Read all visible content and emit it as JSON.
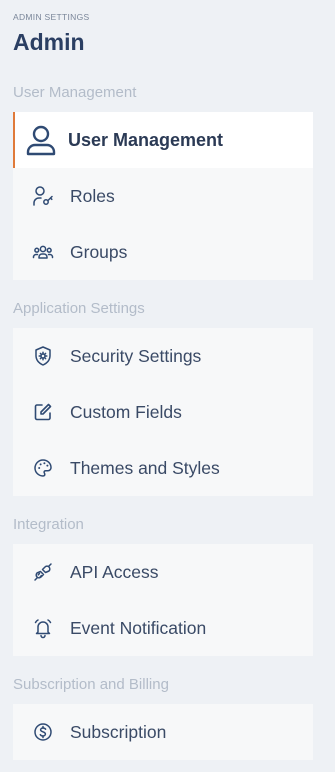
{
  "header": {
    "eyebrow": "ADMIN SETTINGS",
    "title": "Admin"
  },
  "sections": [
    {
      "label": "User Management",
      "items": [
        {
          "label": "User Management",
          "icon": "user-icon",
          "active": true
        },
        {
          "label": "Roles",
          "icon": "user-key-icon",
          "active": false
        },
        {
          "label": "Groups",
          "icon": "users-group-icon",
          "active": false
        }
      ]
    },
    {
      "label": "Application Settings",
      "items": [
        {
          "label": "Security Settings",
          "icon": "shield-gear-icon",
          "active": false
        },
        {
          "label": "Custom Fields",
          "icon": "edit-icon",
          "active": false
        },
        {
          "label": "Themes and Styles",
          "icon": "palette-icon",
          "active": false
        }
      ]
    },
    {
      "label": "Integration",
      "items": [
        {
          "label": "API Access",
          "icon": "plug-icon",
          "active": false
        },
        {
          "label": "Event Notification",
          "icon": "bell-icon",
          "active": false
        }
      ]
    },
    {
      "label": "Subscription and Billing",
      "items": [
        {
          "label": "Subscription",
          "icon": "dollar-circle-icon",
          "active": false
        }
      ]
    }
  ],
  "colors": {
    "accent": "#e07a3a",
    "background": "#eef1f5",
    "text": "#2b3a55",
    "section_label": "#b3bcc9"
  }
}
